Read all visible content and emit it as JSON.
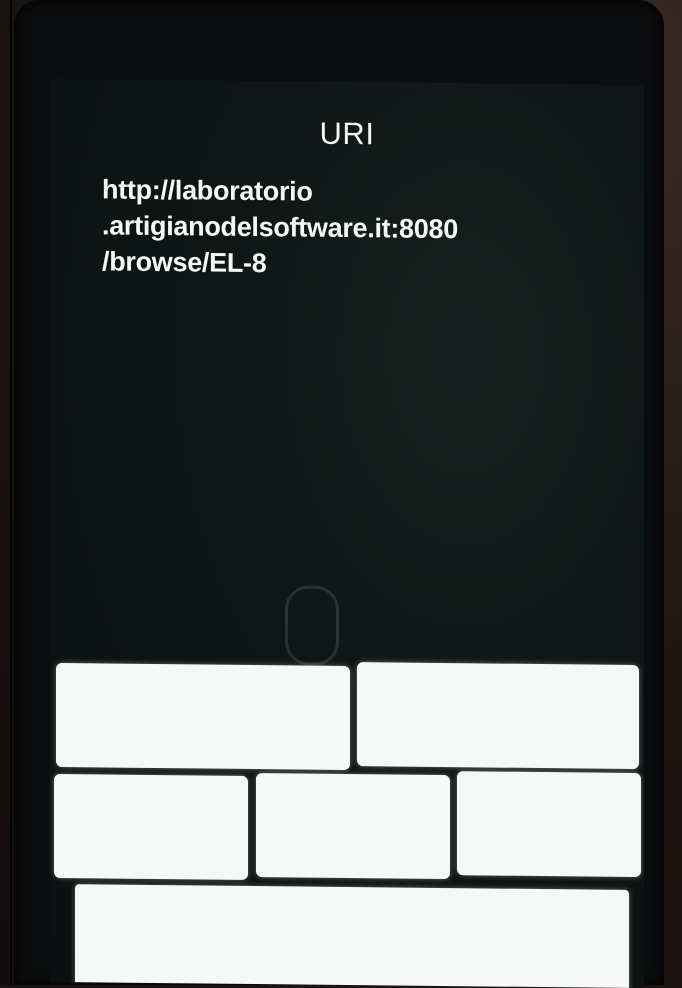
{
  "dialog": {
    "title": "URI",
    "uri_lines": [
      "http://laboratorio",
      ".artigianodelsoftware.it:8080",
      "/browse/EL-8"
    ]
  },
  "keypad": {
    "buttons": [
      "",
      "",
      "",
      "",
      "",
      ""
    ]
  }
}
